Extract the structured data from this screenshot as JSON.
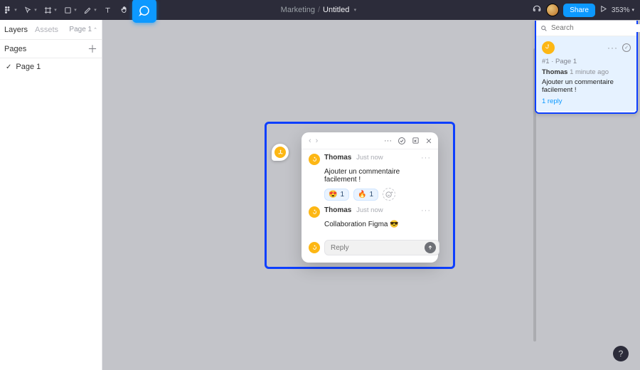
{
  "chrome": {
    "project": "Marketing",
    "title": "Untitled",
    "share_label": "Share",
    "zoom": "353%"
  },
  "left_panel": {
    "tabs": {
      "layers": "Layers",
      "assets": "Assets"
    },
    "page_selector": "Page 1",
    "pages_header": "Pages",
    "pages": [
      "Page 1"
    ]
  },
  "comments_panel": {
    "search_placeholder": "Search",
    "card": {
      "index": "#1",
      "location": "Page 1",
      "author": "Thomas",
      "time": "1 minute ago",
      "message": "Ajouter un commentaire facilement !",
      "reply_link": "1 reply"
    }
  },
  "popover": {
    "messages": [
      {
        "author": "Thomas",
        "time": "Just now",
        "text": "Ajouter un commentaire facilement !",
        "reactions": [
          {
            "emoji": "😍",
            "count": "1"
          },
          {
            "emoji": "🔥",
            "count": "1"
          }
        ]
      },
      {
        "author": "Thomas",
        "time": "Just now",
        "text": "Collaboration Figma 😎"
      }
    ],
    "reply_placeholder": "Reply"
  },
  "help_label": "?"
}
